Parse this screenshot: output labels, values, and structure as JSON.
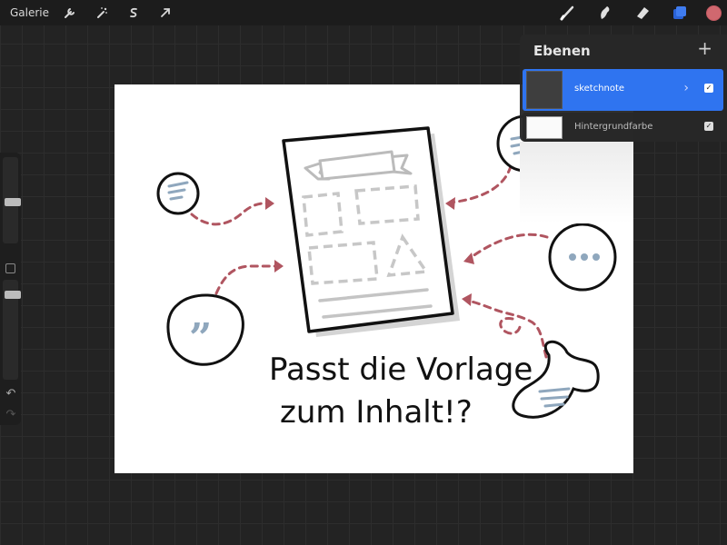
{
  "topbar": {
    "gallery_label": "Galerie",
    "left_tools": [
      "wrench-icon",
      "magic-wand-icon",
      "selection-icon",
      "transform-arrow-icon"
    ],
    "right_tools": [
      "brush-icon",
      "smudge-icon",
      "eraser-icon",
      "layers-icon"
    ],
    "current_color": "#d0686f"
  },
  "layers": {
    "title": "Ebenen",
    "add_label": "+",
    "items": [
      {
        "name": "sketchnote",
        "selected": true,
        "visible": true
      },
      {
        "name": "Hintergrundfarbe",
        "selected": false,
        "visible": true
      }
    ]
  },
  "canvas": {
    "handwritten_text_line1": "Passt die Vorlage",
    "handwritten_text_line2": "zum Inhalt!?",
    "accent_color": "#b05560",
    "outline_color": "#111111"
  }
}
